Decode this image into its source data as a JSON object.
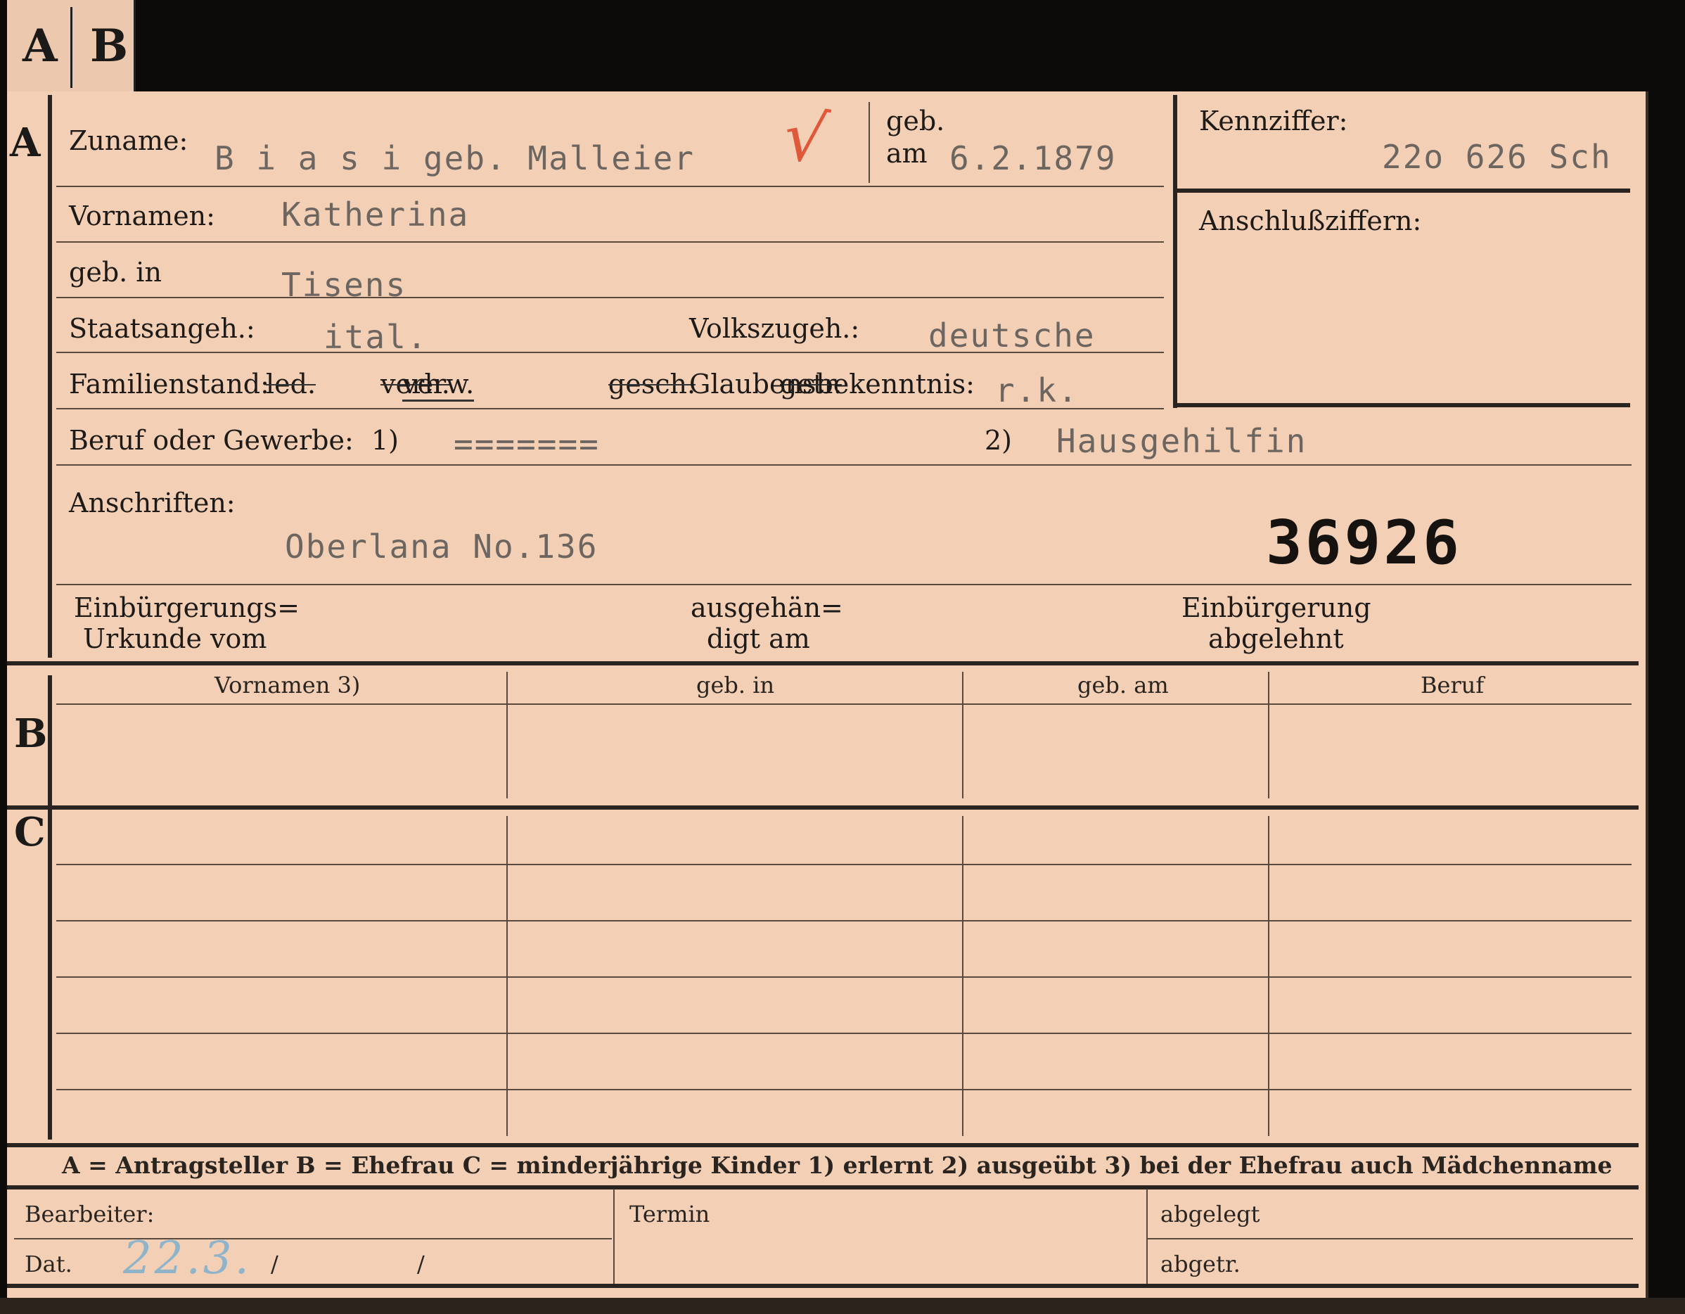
{
  "tabs": [
    "A",
    "B"
  ],
  "sections": {
    "a": "A",
    "b": "B",
    "c": "C"
  },
  "labels": {
    "zuname": "Zuname:",
    "geb": "geb.",
    "am": "am",
    "vornamen": "Vornamen:",
    "geb_in": "geb. in",
    "staatsangeh": "Staatsangeh.:",
    "volkszugeh": "Volkszugeh.:",
    "familienstand": "Familienstand:",
    "fs_led": "led.",
    "fs_verh": "verh.",
    "fs_verw": "verw.",
    "fs_gesch": "gesch.",
    "fs_getr": "getr.",
    "glaubensbekenntnis": "Glaubensbekenntnis:",
    "beruf": "Beruf oder Gewerbe:",
    "note1": "1)",
    "note2": "2)",
    "anschriften": "Anschriften:",
    "einbuergerungs_1": "Einbürgerungs=",
    "einbuergerungs_2": "Urkunde vom",
    "ausgehaen_1": "ausgehän=",
    "ausgehaen_2": "digt am",
    "einbuergerung_1": "Einbürgerung",
    "einbuergerung_2": "abgelehnt",
    "kennziffer": "Kennziffer:",
    "anschlussziffern": "Anschlußziffern:"
  },
  "values": {
    "zuname": "B i a s i  geb. Malleier",
    "check_mark": "√",
    "geb_am": "6.2.1879",
    "kennziffer": "22o 626  Sch",
    "vornamen": "Katherina",
    "geb_in": "Tisens",
    "staatsangeh": "ital.",
    "volkszugeh": "deutsche",
    "glaubensbekenntnis": "r.k.",
    "beruf_erlernt": "=======",
    "beruf_ausgeuebt": "Hausgehilfin",
    "anschrift": "Oberlana No.136",
    "stamp_number": "36926"
  },
  "table": {
    "headers": [
      "Vornamen 3)",
      "geb. in",
      "geb. am",
      "Beruf"
    ]
  },
  "legend": "A = Antragsteller   B = Ehefrau   C = minderjährige Kinder   1) erlernt   2) ausgeübt   3) bei der Ehefrau auch Mädchenname",
  "footer": {
    "bearbeiter": "Bearbeiter:",
    "dat": "Dat.",
    "dat_value": "22.3.",
    "slash1": "/",
    "slash2": "/",
    "termin": "Termin",
    "abgelegt": "abgelegt",
    "abgetr": "abgetr."
  },
  "colors": {
    "card": "#f3d0b5",
    "ink_typed": "#6c6560",
    "check_mark": "#e0573a",
    "handwriting": "#8fb3c9"
  }
}
